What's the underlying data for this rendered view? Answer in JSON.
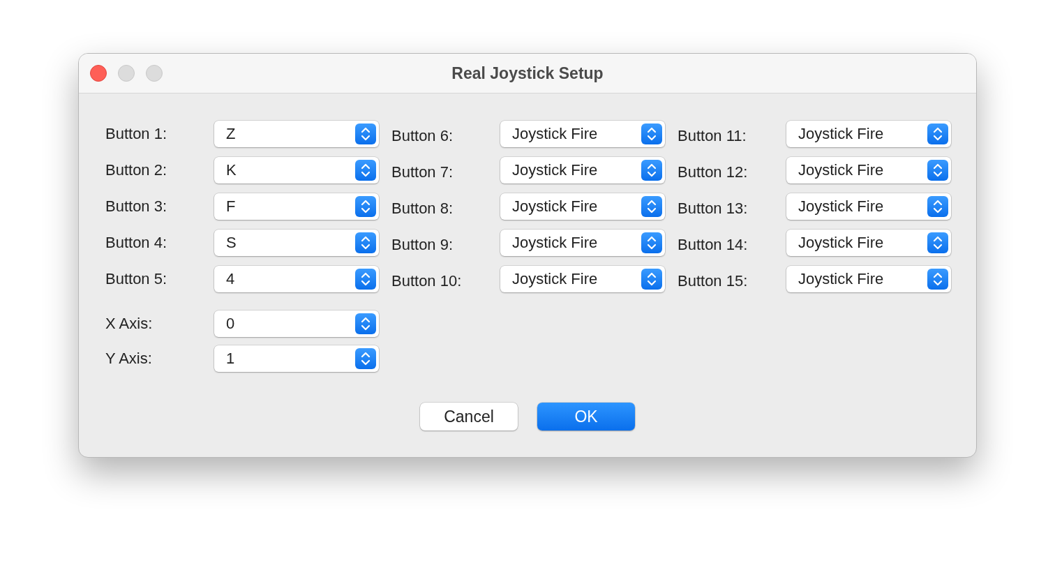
{
  "window": {
    "title": "Real Joystick Setup"
  },
  "button_columns": [
    {
      "rows": [
        {
          "label": "Button 1:",
          "value": "Z"
        },
        {
          "label": "Button 2:",
          "value": "K"
        },
        {
          "label": "Button 3:",
          "value": "F"
        },
        {
          "label": "Button 4:",
          "value": "S"
        },
        {
          "label": "Button 5:",
          "value": "4"
        }
      ]
    },
    {
      "rows": [
        {
          "label": "Button 6:",
          "value": "Joystick Fire"
        },
        {
          "label": "Button 7:",
          "value": "Joystick Fire"
        },
        {
          "label": "Button 8:",
          "value": "Joystick Fire"
        },
        {
          "label": "Button 9:",
          "value": "Joystick Fire"
        },
        {
          "label": "Button 10:",
          "value": "Joystick Fire"
        }
      ]
    },
    {
      "rows": [
        {
          "label": "Button 11:",
          "value": "Joystick Fire"
        },
        {
          "label": "Button 12:",
          "value": "Joystick Fire"
        },
        {
          "label": "Button 13:",
          "value": "Joystick Fire"
        },
        {
          "label": "Button 14:",
          "value": "Joystick Fire"
        },
        {
          "label": "Button 15:",
          "value": "Joystick Fire"
        }
      ]
    }
  ],
  "axes": [
    {
      "label": "X Axis:",
      "value": "0"
    },
    {
      "label": "Y Axis:",
      "value": "1"
    }
  ],
  "buttons": [
    {
      "label": "Cancel",
      "kind": "normal"
    },
    {
      "label": "OK",
      "kind": "default"
    }
  ]
}
